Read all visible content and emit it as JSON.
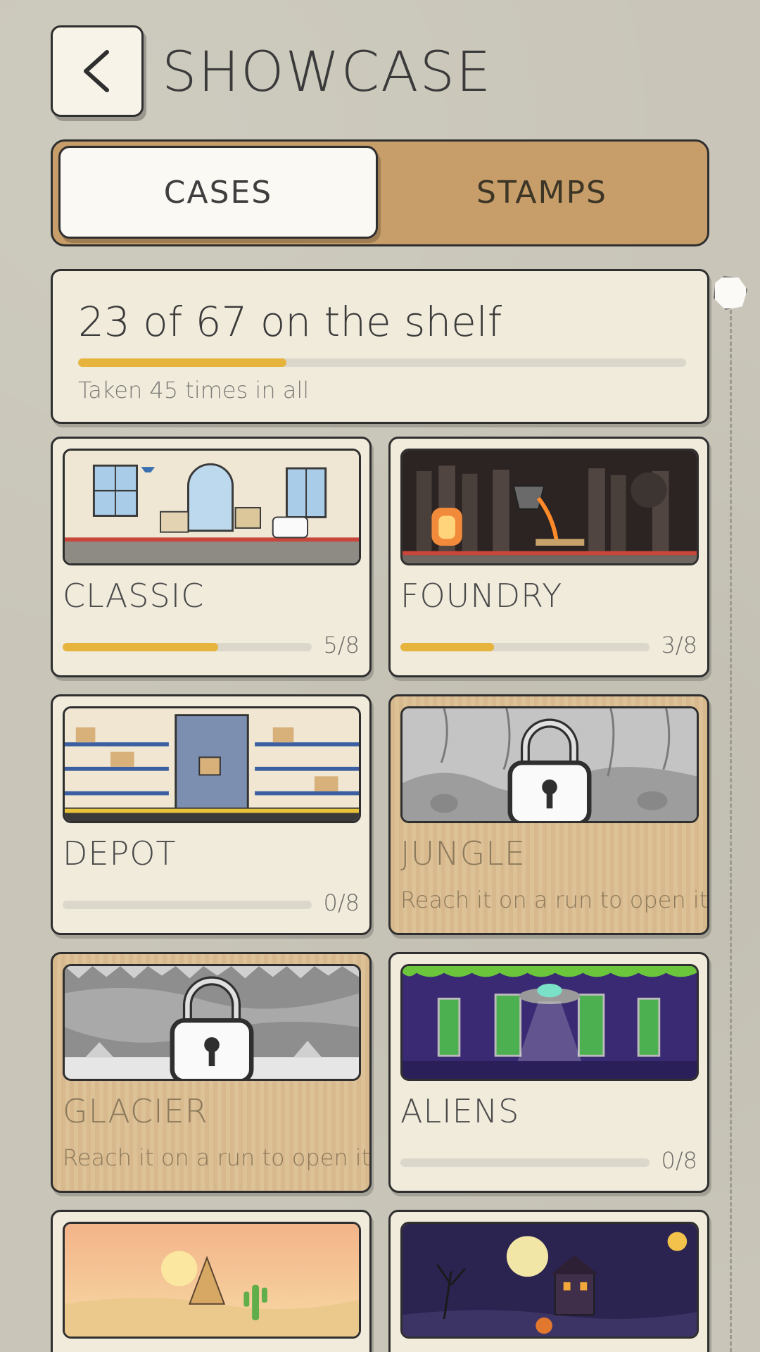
{
  "header": {
    "title": "SHOWCASE",
    "back_icon": "chevron-left-icon"
  },
  "tabs": [
    {
      "label": "CASES",
      "active": true
    },
    {
      "label": "STAMPS",
      "active": false
    }
  ],
  "summary": {
    "heading": "23 of 67 on the shelf",
    "progress": 0.343,
    "subtitle": "Taken 45 times in all"
  },
  "colors": {
    "accent": "#e6b33d",
    "tab_bar": "#c79e69",
    "card_bg": "#f1ebdc",
    "locked_bg": "#d8b98d",
    "page_bg": "#c9c6b9"
  },
  "cards": [
    {
      "name": "CLASSIC",
      "locked": false,
      "count": "5/8",
      "progress": 0.625
    },
    {
      "name": "FOUNDRY",
      "locked": false,
      "count": "3/8",
      "progress": 0.375
    },
    {
      "name": "DEPOT",
      "locked": false,
      "count": "0/8",
      "progress": 0
    },
    {
      "name": "JUNGLE",
      "locked": true,
      "message": "Reach it on a run to open it"
    },
    {
      "name": "GLACIER",
      "locked": true,
      "message": "Reach it on a run to open it"
    },
    {
      "name": "ALIENS",
      "locked": false,
      "count": "0/8",
      "progress": 0
    },
    {
      "name": "",
      "locked": false
    },
    {
      "name": "",
      "locked": false
    }
  ]
}
